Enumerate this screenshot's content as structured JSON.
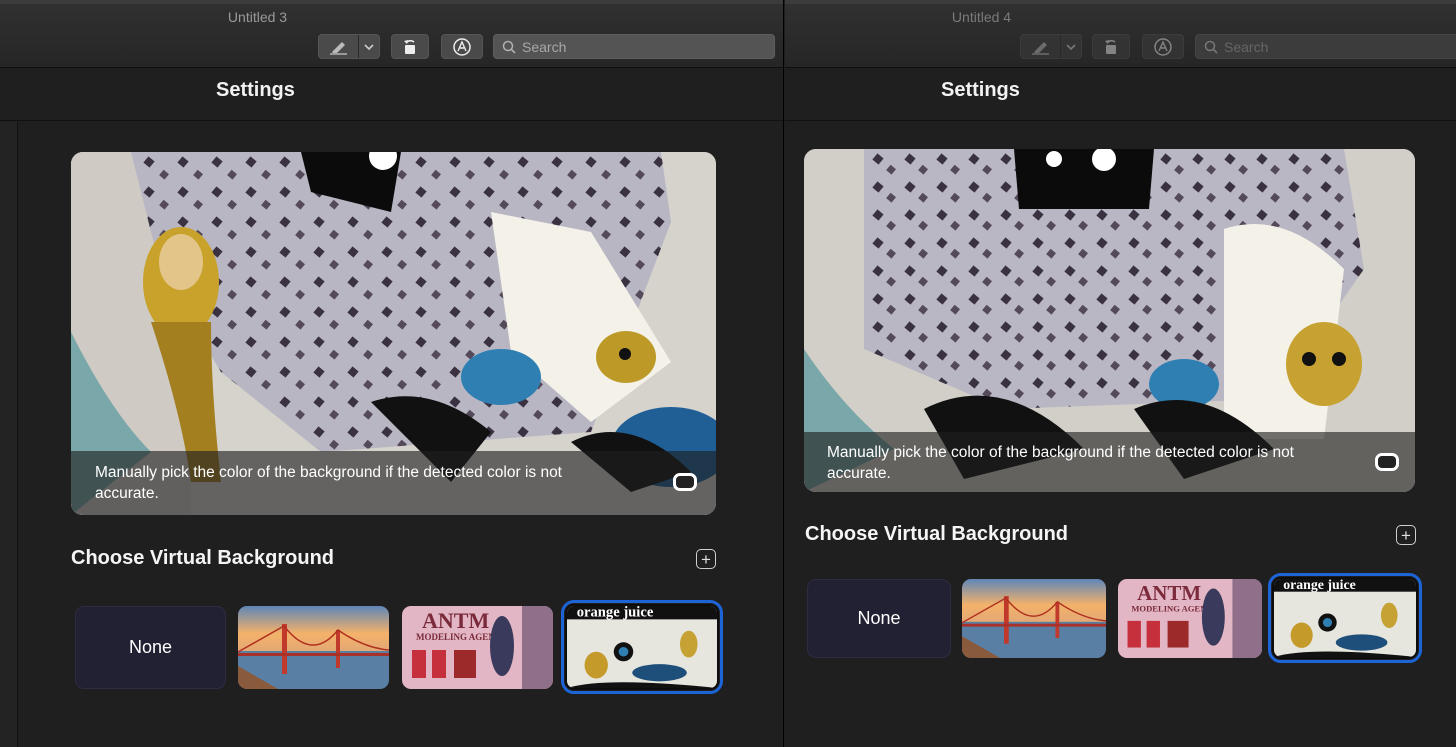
{
  "windows": [
    {
      "id": "left",
      "title": "Untitled 3",
      "search_placeholder": "Search",
      "settings_title": "Settings",
      "preview_caption": "Manually pick the color of the background if the detected color is not accurate.",
      "section_title": "Choose Virtual Background",
      "add_label": "+",
      "backgrounds": [
        {
          "label": "None"
        },
        {
          "name": "golden-gate-bridge"
        },
        {
          "name": "antm-poster",
          "text": "ANTM",
          "subtext": "MODELING AGENCY"
        },
        {
          "name": "orange-juice-collage",
          "text": "orange juice",
          "selected": true
        }
      ]
    },
    {
      "id": "right",
      "title": "Untitled 4",
      "search_placeholder": "Search",
      "settings_title": "Settings",
      "preview_caption": "Manually pick the color of the background if the detected color is not accurate.",
      "section_title": "Choose Virtual Background",
      "add_label": "+",
      "backgrounds": [
        {
          "label": "None"
        },
        {
          "name": "golden-gate-bridge"
        },
        {
          "name": "antm-poster",
          "text": "ANTM",
          "subtext": "MODELING AGENCY"
        },
        {
          "name": "orange-juice-collage",
          "text": "orange juice",
          "selected": true
        }
      ]
    }
  ],
  "toolbar_icons": [
    "pen-icon",
    "chevron-down-icon",
    "rotate-icon",
    "markup-icon",
    "search-icon"
  ],
  "colors": {
    "window_bg": "#1f1f1f",
    "titlebar": "#2b2b2b",
    "selection_outline": "#1d64d8",
    "none_tile": "#222033"
  }
}
